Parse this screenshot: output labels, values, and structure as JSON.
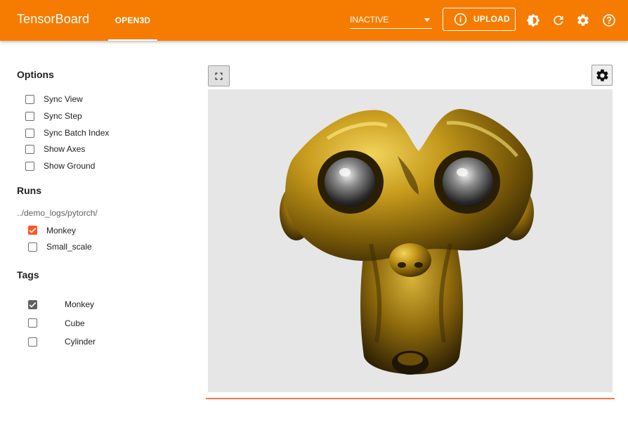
{
  "header": {
    "brand": "TensorBoard",
    "active_tab": "OPEN3D",
    "run_select_value": "INACTIVE",
    "upload_label": "UPLOAD",
    "icons": [
      "theme-toggle-icon",
      "refresh-icon",
      "settings-icon",
      "help-icon"
    ],
    "accent_color": "#f57c00"
  },
  "sidebar": {
    "options_title": "Options",
    "options": [
      {
        "label": "Sync View",
        "checked": false
      },
      {
        "label": "Sync Step",
        "checked": false
      },
      {
        "label": "Sync Batch Index",
        "checked": false
      },
      {
        "label": "Show Axes",
        "checked": false
      },
      {
        "label": "Show Ground",
        "checked": false
      }
    ],
    "runs_title": "Runs",
    "runs_path": "../demo_logs/pytorch/",
    "runs": [
      {
        "label": "Monkey",
        "checked": true,
        "color": "#ff5722"
      },
      {
        "label": "Small_scale",
        "checked": false
      }
    ],
    "tags_title": "Tags",
    "tags": [
      {
        "label": "Monkey",
        "checked": true
      },
      {
        "label": "Cube",
        "checked": false
      },
      {
        "label": "Cylinder",
        "checked": false
      }
    ]
  },
  "viewer": {
    "model": "golden-monkey-head",
    "progress": 1.0,
    "progress_color": "#f4764b"
  }
}
